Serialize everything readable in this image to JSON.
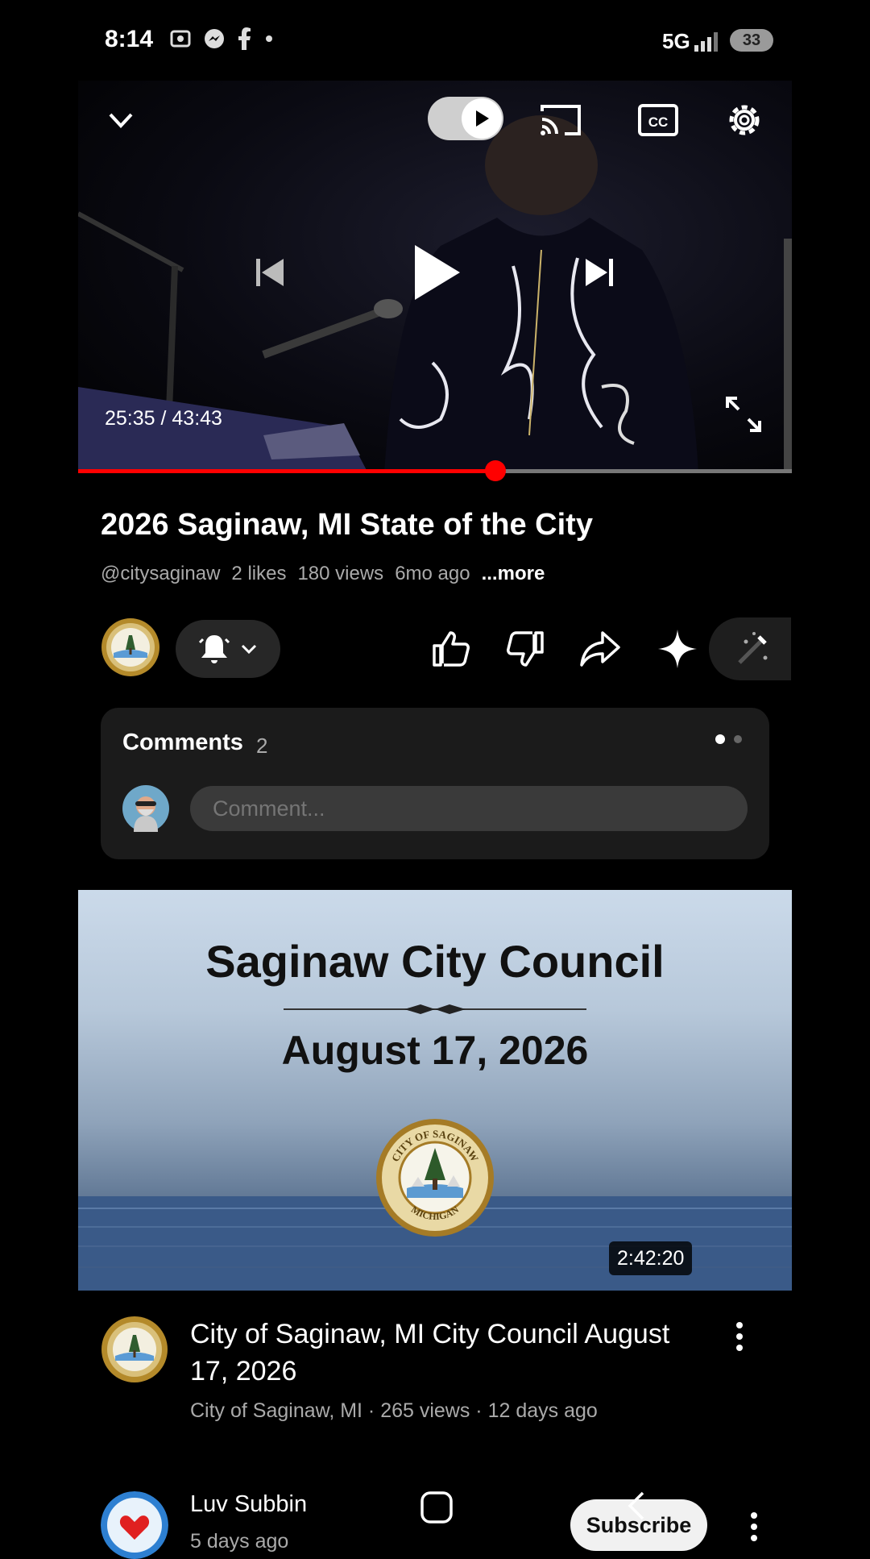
{
  "status_bar": {
    "time": "8:14",
    "network": "5G",
    "battery": "33"
  },
  "player": {
    "time_readout": "25:35 / 43:43",
    "progress_fraction": 0.585
  },
  "video": {
    "title": "2026 Saginaw, MI State of the City",
    "channel_handle": "@citysaginaw",
    "likes": "2 likes",
    "views": "180 views",
    "age": "6mo ago",
    "more_label": "...more"
  },
  "comments": {
    "label": "Comments",
    "count": "2",
    "placeholder": "Comment..."
  },
  "recommended": {
    "thumb_title": "Saginaw City Council",
    "thumb_date": "August 17, 2026",
    "seal_top_text": "CITY OF SAGINAW",
    "seal_bottom_text": "MICHIGAN",
    "duration": "2:42:20",
    "title": "City of Saginaw, MI City Council August 17, 2026",
    "meta": "City of Saginaw, MI · 265 views · 12 days ago"
  },
  "next_item": {
    "channel": "Luv Subbin",
    "age": "5 days ago",
    "subscribe_label": "Subscribe"
  },
  "colors": {
    "accent": "#ff0000",
    "background": "#000000",
    "card": "#1b1b1b"
  }
}
